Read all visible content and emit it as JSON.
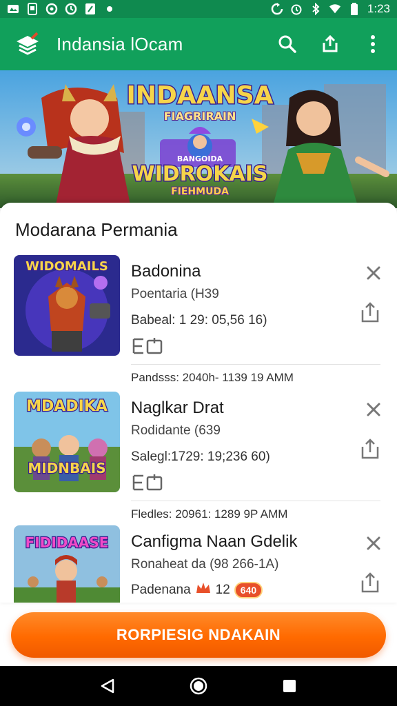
{
  "status_bar": {
    "time": "1:23",
    "left_icons": [
      "notification-icon",
      "sim-icon",
      "circle-icon",
      "circle-icon",
      "app-icon",
      "dot-icon"
    ],
    "right_icons": [
      "sync-icon",
      "alarm-icon",
      "bluetooth-icon",
      "wifi-icon",
      "battery-icon"
    ]
  },
  "app_bar": {
    "title": "Indansia lOcam",
    "actions": [
      "search-icon",
      "share-icon",
      "more-vert-icon"
    ]
  },
  "banner": {
    "headline": "INDAANSA",
    "subheadline": "FIAGRIRAIN",
    "small_text": "BANGOIDA",
    "title2": "WIDROKAIS",
    "subtitle2": "FIEHMUDA"
  },
  "section": {
    "title": "Modarana Permania"
  },
  "games": [
    {
      "name": "Badonina",
      "subtitle": "Poentaria (H39",
      "meta": "Babeal: 1 29: 05,56 16)",
      "footer": "Pandsss: 2040h- 1139 19 AMM",
      "thumb_title": "WIDOMAILS"
    },
    {
      "name": "Naglkar Drat",
      "subtitle": "Rodidante (639",
      "meta": "Salegl:1729: 19;236 60)",
      "footer": "Fledles: 20961: 1289 9P AMM",
      "thumb_title": "MDADIKA",
      "thumb_sub": "MIDNBAIS"
    },
    {
      "name": "Canfigma Naan Gdelik",
      "subtitle": "Ronaheat da (98 266-1A)",
      "price_label": "Padenana",
      "price_value": "12",
      "coin": "640",
      "thumb_title": "FIDIDAASE"
    }
  ],
  "cta": {
    "label": "RORPIESIG NDAKAIN"
  },
  "nav": [
    "back-icon",
    "home-icon",
    "recents-icon"
  ],
  "colors": {
    "status_bar": "#0f8a4f",
    "app_bar": "#11a05b",
    "cta": "#ff6a00"
  }
}
